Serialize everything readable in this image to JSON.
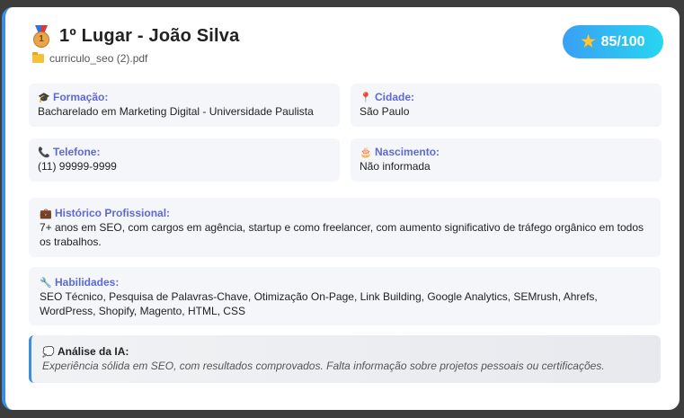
{
  "header": {
    "medal_rank": "1",
    "title": "1º Lugar - João Silva",
    "file_name": "curriculo_seo (2).pdf"
  },
  "score": {
    "value": "85/100"
  },
  "fields": {
    "formacao": {
      "label": "Formação:",
      "value": "Bacharelado em Marketing Digital - Universidade Paulista",
      "icon": "graduation-cap-icon"
    },
    "cidade": {
      "label": "Cidade:",
      "value": "São Paulo",
      "icon": "map-pin-icon"
    },
    "telefone": {
      "label": "Telefone:",
      "value": "(11) 99999-9999",
      "icon": "phone-icon"
    },
    "nascimento": {
      "label": "Nascimento:",
      "value": "Não informada",
      "icon": "birthday-cake-icon"
    },
    "historico": {
      "label": "Histórico Profissional:",
      "value": "7+ anos em SEO, com cargos em agência, startup e como freelancer, com aumento significativo de tráfego orgânico em todos os trabalhos.",
      "icon": "briefcase-icon"
    },
    "habilidades": {
      "label": "Habilidades:",
      "value": "SEO Técnico, Pesquisa de Palavras-Chave, Otimização On-Page, Link Building, Google Analytics, SEMrush, Ahrefs, WordPress, Shopify, Magento, HTML, CSS",
      "icon": "wrench-icon"
    }
  },
  "ai_analysis": {
    "label": "Análise da IA:",
    "text": "Experiência sólida em SEO, com resultados comprovados. Falta informação sobre projetos pessoais ou certificações.",
    "icon": "speech-bubble-icon"
  },
  "colors": {
    "accent": "#3b8fe0",
    "label": "#5e6ad2",
    "score_gradient_start": "#3aa0f5",
    "score_gradient_end": "#27d6f0"
  }
}
